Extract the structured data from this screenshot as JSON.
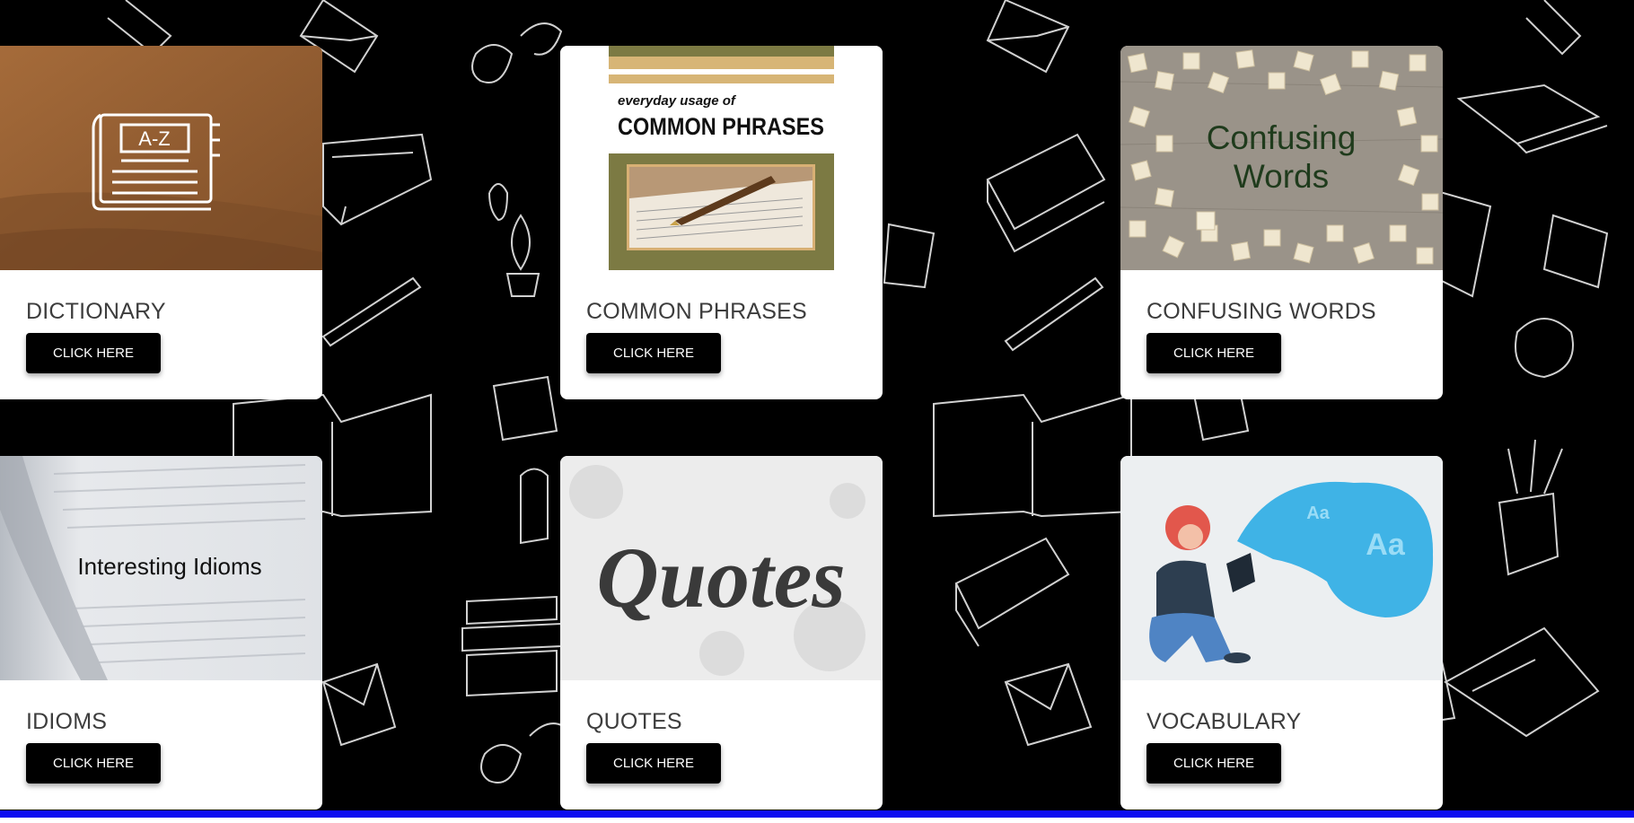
{
  "cards": [
    {
      "title": "DICTIONARY",
      "button": "CLICK HERE",
      "image_text": "A-Z"
    },
    {
      "title": "COMMON PHRASES",
      "button": "CLICK HERE",
      "image_text_1": "everyday usage of",
      "image_text_2": "COMMON PHRASES"
    },
    {
      "title": "CONFUSING WORDS",
      "button": "CLICK HERE",
      "image_text_1": "Confusing",
      "image_text_2": "Words"
    },
    {
      "title": "IDIOMS",
      "button": "CLICK HERE",
      "image_text": "Interesting Idioms"
    },
    {
      "title": "QUOTES",
      "button": "CLICK HERE",
      "image_text": "Quotes"
    },
    {
      "title": "VOCABULARY",
      "button": "CLICK HERE",
      "image_text_1": "Aa",
      "image_text_2": "Aa"
    }
  ],
  "colors": {
    "background": "#000000",
    "card": "#ffffff",
    "button": "#000000",
    "bottom_bar": "#0c0cf0"
  }
}
